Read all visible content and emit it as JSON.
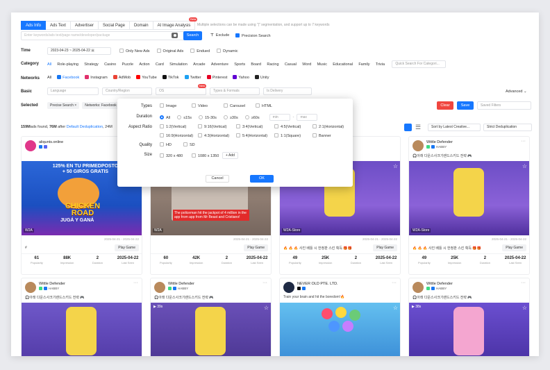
{
  "tabs": [
    {
      "label": "Ads Info",
      "active": true
    },
    {
      "label": "Ads Text",
      "active": false
    },
    {
      "label": "Advertiser",
      "active": false
    },
    {
      "label": "Social Page",
      "active": false
    },
    {
      "label": "Domain",
      "active": false
    },
    {
      "label": "AI Image Analysis",
      "active": false,
      "badge": "Beta"
    }
  ],
  "hint": "Multiple selections can be made using \"|\" segmentation, and support up to 7 keywords",
  "search": {
    "placeholder": "Enter keywords/ads text/page name/developer/package",
    "button": "Search",
    "exclude": "Exclude",
    "precision": "Precision Search"
  },
  "filters": {
    "time": {
      "label": "Time",
      "start": "2023-04-23",
      "sep": "~",
      "end": "2025-04-22",
      "options": [
        "Only New Ads",
        "Original Ads",
        "Endued",
        "Dynamic"
      ]
    },
    "category": {
      "label": "Category",
      "items": [
        "All",
        "Role-playing",
        "Strategy",
        "Casino",
        "Puzzle",
        "Action",
        "Card",
        "Simulation",
        "Arcade",
        "Adventure",
        "Sports",
        "Board",
        "Racing",
        "Casual",
        "Word",
        "Music",
        "Educational",
        "Family",
        "Trivia"
      ],
      "quick_placeholder": "Quick Search For Categori..."
    },
    "networks": {
      "label": "Networks",
      "items": [
        {
          "name": "All",
          "color": ""
        },
        {
          "name": "Facebook",
          "color": "#1877f2"
        },
        {
          "name": "Instagram",
          "color": "#e1306c"
        },
        {
          "name": "AdMob",
          "color": "#ea4335"
        },
        {
          "name": "YouTube",
          "color": "#ff0000"
        },
        {
          "name": "TikTok",
          "color": "#111111"
        },
        {
          "name": "Twitter",
          "color": "#1da1f2"
        },
        {
          "name": "Pinterest",
          "color": "#e60023"
        },
        {
          "name": "Yahoo",
          "color": "#6001d2"
        },
        {
          "name": "Unity",
          "color": "#222222"
        }
      ]
    },
    "basic": {
      "label": "Basic",
      "language": "Language",
      "country": "Country/Region",
      "os": "OS",
      "os_badge": "New",
      "types": "Types & Formats",
      "delivery": "Is Delivery",
      "advanced": "Advanced"
    },
    "selected": {
      "label": "Selected",
      "chips": [
        "Precise Search ×",
        "Networks: Facebook"
      ],
      "clear": "Clear",
      "save": "Save",
      "saved_placeholder": "Saved Filters"
    }
  },
  "results": {
    "prefix": "159M",
    "count_text": "ads found, ",
    "dedup_count": "76M",
    "dedup_text": " after ",
    "dedup_link": "Default Deduplication",
    "suffix": ", 24M"
  },
  "sort": {
    "label": "Sort by Latest Creative...",
    "dedup": "Strict Deduplication"
  },
  "modal": {
    "types_label": "Types",
    "types": [
      "Image",
      "Video",
      "Carousel",
      "HTML"
    ],
    "duration_label": "Duration",
    "duration": [
      "All",
      "≤15s",
      "15-30s",
      "≥30s",
      "≥60s"
    ],
    "min": "min",
    "max": "max",
    "dash": "-",
    "aspect_label": "Aspect Ratio",
    "aspect": [
      "1:2(Vertical)",
      "9:16(Vertical)",
      "3:4(Vertical)",
      "4:5(Vertical)",
      "2:1(Horizontal)",
      "16:9(Horizontal)",
      "4:3(Horizontal)",
      "5:4(Horizontal)",
      "1:1(Square)",
      "Banner"
    ],
    "quality_label": "Quality",
    "quality": [
      "HD",
      "SD"
    ],
    "size_label": "Size",
    "sizes": [
      "320 x 480",
      "1080 x 1350"
    ],
    "add": "+  Add",
    "cancel": "Cancel",
    "ok": "OK"
  },
  "cards": [
    {
      "name": "aliqunts.online",
      "desc": "",
      "date": "2025-04-21 - 2025-04-22",
      "tag": "W2A",
      "play": "Play Game",
      "emoji": "#",
      "stats": [
        [
          "61",
          "Popularity"
        ],
        [
          "88K",
          "Impression"
        ],
        [
          "2",
          "Duration"
        ],
        [
          "2025-04-22",
          "Last Seen"
        ]
      ],
      "media_color": "#1c5bd6"
    },
    {
      "name": "",
      "desc": "",
      "date": "2025-04-21 - 2025-04-22",
      "tag": "W2A",
      "play": "Play Game",
      "emoji": "",
      "overlay": "The policeman hit the jackpot of 4 million in the app from app from Mr Beast and Cristiano!",
      "stats": [
        [
          "60",
          "Popularity"
        ],
        [
          "42K",
          "Impression"
        ],
        [
          "2",
          "Duration"
        ],
        [
          "2025-04-22",
          "Last Seen"
        ]
      ],
      "media_color": "#8d7e74"
    },
    {
      "name": "",
      "desc": "",
      "date": "2025-04-21 - 2025-04-22",
      "tag": "W2A-Store",
      "play": "Play Game",
      "emoji": "🔥 🔥 🔥 사진 배틀 시 한정판 스킨 획득 🎁🎁",
      "stats": [
        [
          "49",
          "Popularity"
        ],
        [
          "25K",
          "Impression"
        ],
        [
          "2",
          "Duration"
        ],
        [
          "2025-04-22",
          "Last Seen"
        ]
      ],
      "media_color": "#7b55c9"
    },
    {
      "name": "Wittle Defender",
      "desc": "🎧아래 다운스사크기랜드스키드 전략 🎮",
      "handle": "HABBY",
      "date": "2025-04-21 - 2025-04-22",
      "tag": "W2A-Store",
      "play": "Play Game",
      "emoji": "🔥 🔥 🔥 사진 배틀 시 한정판 스킨 획득 🎁🎁",
      "stats": [
        [
          "49",
          "Popularity"
        ],
        [
          "25K",
          "Impression"
        ],
        [
          "2",
          "Duration"
        ],
        [
          "2025-04-22",
          "Last Seen"
        ]
      ],
      "media_color": "#7b55c9"
    },
    {
      "name": "Wittle Defender",
      "handle": "HABBY",
      "desc": "🎧아래 다운스사크기랜드스키드 전략 🎮",
      "media_color": "#6f58c9",
      "time": ""
    },
    {
      "name": "Wittle Defender",
      "handle": "HABBY",
      "desc": "🎧아래 다운스사크기랜드스키드 전략 🎮",
      "media_color": "#6a50b8",
      "time": "39s"
    },
    {
      "name": "NEVER OLD PTE. LTD.",
      "handle": "",
      "desc": "Train your brain and hit the boredom!🔥",
      "media_color": "#3ba6e6",
      "time": ""
    },
    {
      "name": "Wittle Defender",
      "handle": "HABBY",
      "desc": "🎧아래 다운스사크기랜드스키드 전략 🎮",
      "media_color": "#6b4fd0",
      "time": "38s"
    }
  ]
}
